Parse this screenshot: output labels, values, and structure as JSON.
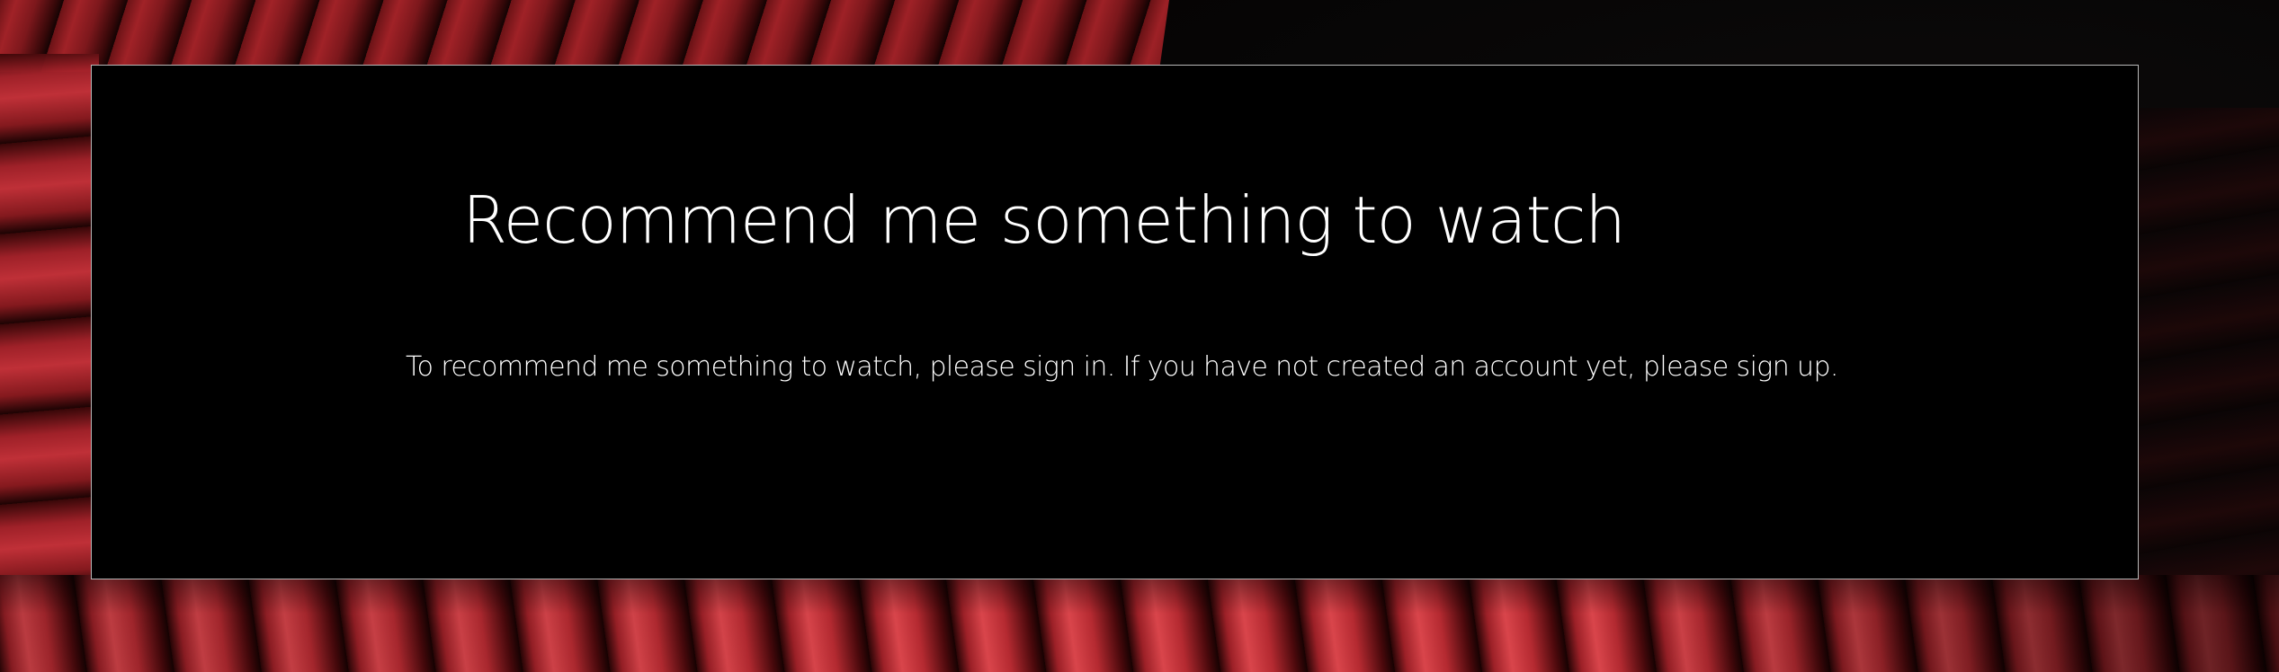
{
  "page": {
    "title": "Recommend me something to watch",
    "message": "To recommend me something to watch, please sign in. If you have not created an account yet, please sign up."
  },
  "background": {
    "image": "theater-seats-photo",
    "accent_color": "#b8262c"
  },
  "panel": {
    "background_color": "#000000",
    "border_color": "#b9b9b9"
  }
}
